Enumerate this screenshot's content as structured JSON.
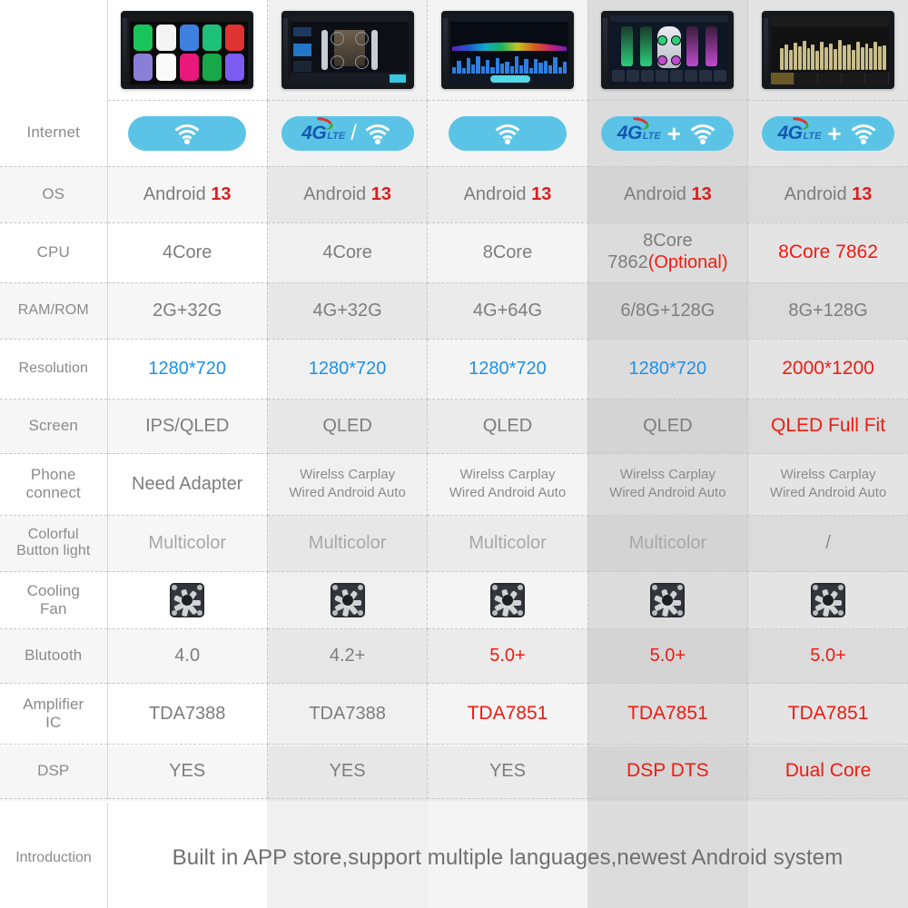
{
  "meta": {
    "title": "Car Stereo Android Head Unit Model Comparison Chart",
    "accent_blue": "#1e90e8",
    "accent_red": "#ee1c12",
    "badge_blue": "#5bc4e6",
    "text_gray": "#7d7d7d"
  },
  "columns": [
    {
      "id": "model-1",
      "thumb": "android-app-grid-screen"
    },
    {
      "id": "model-2",
      "thumb": "audio-fader-balance-screen"
    },
    {
      "id": "model-3",
      "thumb": "rainbow-spectrum-analyzer-screen"
    },
    {
      "id": "model-4",
      "thumb": "dsp-tuning-sliders-screen"
    },
    {
      "id": "model-5",
      "thumb": "31-band-equalizer-screen"
    }
  ],
  "rows": {
    "thumbnails": {
      "label": ""
    },
    "internet": {
      "label": "Internet",
      "values": [
        {
          "type": "wifi",
          "icons": [
            "wifi-icon"
          ]
        },
        {
          "type": "lte-slash-wifi",
          "lte": "4G",
          "lte_sub": "LTE",
          "separator": "/",
          "icons": [
            "4g-lte-icon",
            "wifi-icon"
          ]
        },
        {
          "type": "wifi",
          "icons": [
            "wifi-icon"
          ]
        },
        {
          "type": "lte-plus-wifi",
          "lte": "4G",
          "lte_sub": "LTE",
          "separator": "+",
          "icons": [
            "4g-lte-icon",
            "wifi-icon"
          ]
        },
        {
          "type": "lte-plus-wifi",
          "lte": "4G",
          "lte_sub": "LTE",
          "separator": "+",
          "icons": [
            "4g-lte-icon",
            "wifi-icon"
          ]
        }
      ]
    },
    "os": {
      "label": "OS",
      "values": [
        {
          "text": "Android ",
          "highlight": "13"
        },
        {
          "text": "Android ",
          "highlight": "13"
        },
        {
          "text": "Android ",
          "highlight": "13"
        },
        {
          "text": "Android ",
          "highlight": "13"
        },
        {
          "text": "Android ",
          "highlight": "13"
        }
      ]
    },
    "cpu": {
      "label": "CPU",
      "values": [
        {
          "text": "4Core",
          "style": "gray"
        },
        {
          "text": "4Core",
          "style": "gray"
        },
        {
          "text": "8Core",
          "style": "gray"
        },
        {
          "line1": "8Core",
          "line2_text": "7862",
          "line2_highlight": "(Optional)",
          "style": "gray-with-red"
        },
        {
          "text": "8Core 7862",
          "style": "red"
        }
      ]
    },
    "ram_rom": {
      "label": "RAM/ROM",
      "values": [
        {
          "text": "2G+32G",
          "style": "gray"
        },
        {
          "text": "4G+32G",
          "style": "gray"
        },
        {
          "text": "4G+64G",
          "style": "gray"
        },
        {
          "text": "6/8G+128G",
          "style": "gray"
        },
        {
          "text": "8G+128G",
          "style": "gray"
        }
      ]
    },
    "resolution": {
      "label": "Resolution",
      "values": [
        {
          "text": "1280*720",
          "style": "blue"
        },
        {
          "text": "1280*720",
          "style": "blue"
        },
        {
          "text": "1280*720",
          "style": "blue"
        },
        {
          "text": "1280*720",
          "style": "blue"
        },
        {
          "text": "2000*1200",
          "style": "red"
        }
      ]
    },
    "screen": {
      "label": "Screen",
      "values": [
        {
          "text": "IPS/QLED",
          "style": "gray"
        },
        {
          "text": "QLED",
          "style": "gray"
        },
        {
          "text": "QLED",
          "style": "gray"
        },
        {
          "text": "QLED",
          "style": "gray"
        },
        {
          "text": "QLED Full Fit",
          "style": "red"
        }
      ]
    },
    "phone_connect": {
      "label_line1": "Phone",
      "label_line2": "connect",
      "values": [
        {
          "text": "Need Adapter",
          "style": "gray-large"
        },
        {
          "line1": "Wirelss Carplay",
          "line2": "Wired Android Auto",
          "style": "gray-small"
        },
        {
          "line1": "Wirelss Carplay",
          "line2": "Wired Android Auto",
          "style": "gray-small"
        },
        {
          "line1": "Wirelss Carplay",
          "line2": "Wired Android Auto",
          "style": "gray-small"
        },
        {
          "line1": "Wirelss Carplay",
          "line2": "Wired Android Auto",
          "style": "gray-small"
        }
      ]
    },
    "button_light": {
      "label_line1": "Colorful",
      "label_line2": "Button light",
      "values": [
        {
          "text": "Multicolor",
          "style": "gray-lite"
        },
        {
          "text": "Multicolor",
          "style": "gray-lite"
        },
        {
          "text": "Multicolor",
          "style": "gray-lite"
        },
        {
          "text": "Multicolor",
          "style": "gray-lite"
        },
        {
          "text": "/",
          "style": "gray-lite"
        }
      ]
    },
    "cooling_fan": {
      "label_line1": "Cooling",
      "label_line2": "Fan",
      "values": [
        {
          "type": "icon",
          "icon": "cooling-fan-icon"
        },
        {
          "type": "icon",
          "icon": "cooling-fan-icon"
        },
        {
          "type": "icon",
          "icon": "cooling-fan-icon"
        },
        {
          "type": "icon",
          "icon": "cooling-fan-icon"
        },
        {
          "type": "icon",
          "icon": "cooling-fan-icon"
        }
      ]
    },
    "bluetooth": {
      "label": "Blutooth",
      "values": [
        {
          "text": "4.0",
          "style": "gray"
        },
        {
          "text": "4.2+",
          "style": "gray"
        },
        {
          "text": "5.0+",
          "style": "red"
        },
        {
          "text": "5.0+",
          "style": "red"
        },
        {
          "text": "5.0+",
          "style": "red"
        }
      ]
    },
    "amplifier_ic": {
      "label_line1": "Amplifier",
      "label_line2": "IC",
      "values": [
        {
          "text": "TDA7388",
          "style": "gray"
        },
        {
          "text": "TDA7388",
          "style": "gray"
        },
        {
          "text": "TDA7851",
          "style": "red"
        },
        {
          "text": "TDA7851",
          "style": "red"
        },
        {
          "text": "TDA7851",
          "style": "red"
        }
      ]
    },
    "dsp": {
      "label": "DSP",
      "values": [
        {
          "text": "YES",
          "style": "gray"
        },
        {
          "text": "YES",
          "style": "gray"
        },
        {
          "text": "YES",
          "style": "gray"
        },
        {
          "text": "DSP DTS",
          "style": "red"
        },
        {
          "text": "Dual Core",
          "style": "red"
        }
      ]
    }
  },
  "footer": {
    "label": "Introduction",
    "text": "Built in APP store,support multiple languages,newest Android system"
  }
}
